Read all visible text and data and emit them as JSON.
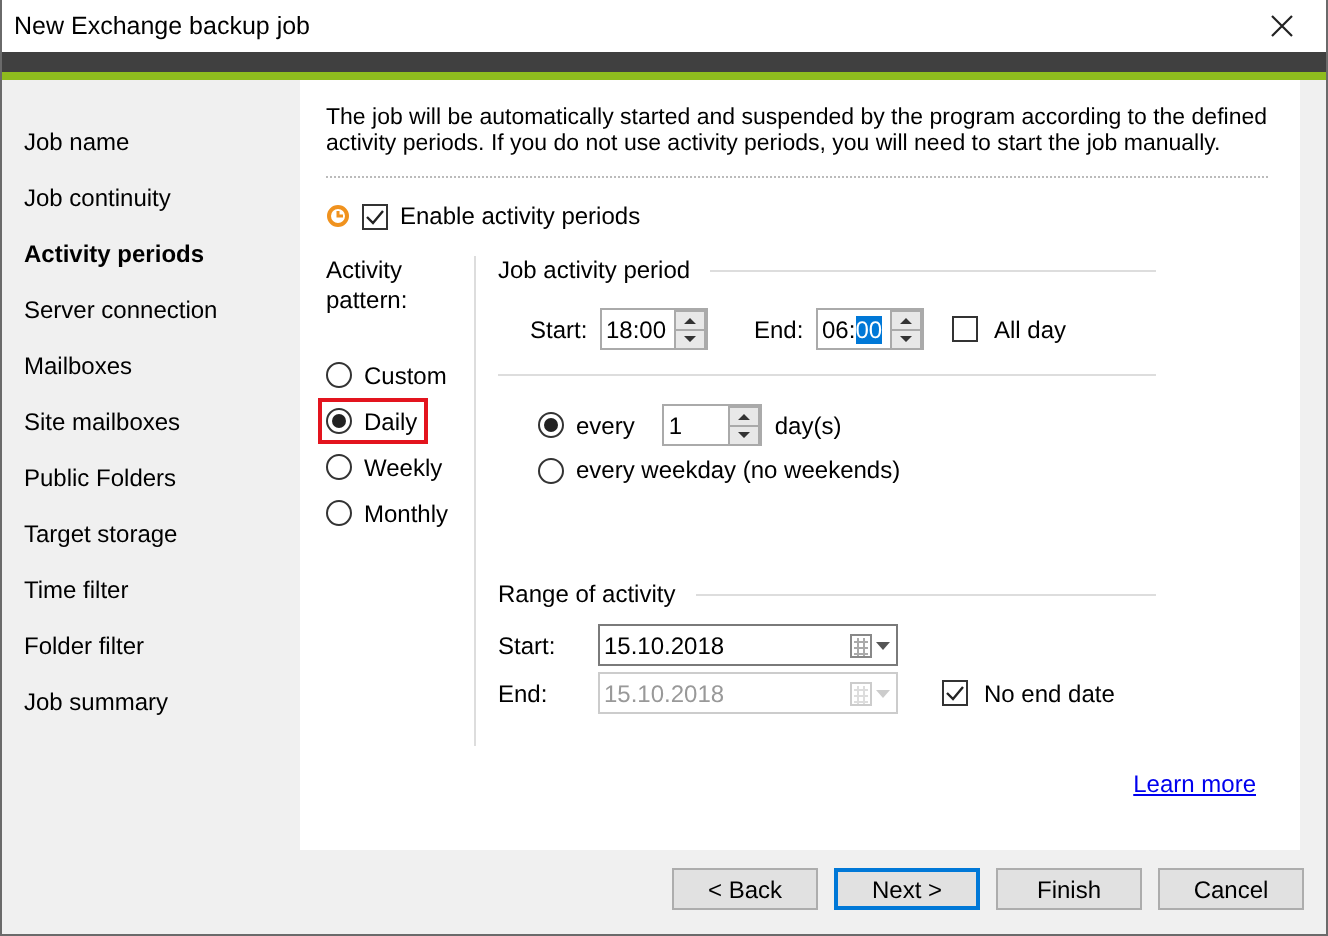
{
  "window": {
    "title": "New Exchange backup job"
  },
  "sidebar": {
    "items": [
      {
        "label": "Job name",
        "selected": false
      },
      {
        "label": "Job continuity",
        "selected": false
      },
      {
        "label": "Activity periods",
        "selected": true
      },
      {
        "label": "Server connection",
        "selected": false
      },
      {
        "label": "Mailboxes",
        "selected": false
      },
      {
        "label": "Site mailboxes",
        "selected": false
      },
      {
        "label": "Public Folders",
        "selected": false
      },
      {
        "label": "Target storage",
        "selected": false
      },
      {
        "label": "Time filter",
        "selected": false
      },
      {
        "label": "Folder filter",
        "selected": false
      },
      {
        "label": "Job summary",
        "selected": false
      }
    ]
  },
  "description": "The job will be automatically started and suspended by the program according to the defined activity periods. If you do not use activity periods, you will need to start the job manually.",
  "enable_activity_periods": {
    "label": "Enable activity periods",
    "checked": true
  },
  "activity_pattern": {
    "label": "Activity pattern:",
    "options": [
      {
        "label": "Custom",
        "selected": false,
        "highlighted": false
      },
      {
        "label": "Daily",
        "selected": true,
        "highlighted": true
      },
      {
        "label": "Weekly",
        "selected": false,
        "highlighted": false
      },
      {
        "label": "Monthly",
        "selected": false,
        "highlighted": false
      }
    ]
  },
  "job_activity_period": {
    "title": "Job activity period",
    "start_label": "Start:",
    "start_value": "18:00",
    "end_label": "End:",
    "end_hours": "06:",
    "end_minutes": "00",
    "end_minutes_selected": true,
    "all_day": {
      "label": "All day",
      "checked": false
    }
  },
  "recurrence": [
    {
      "kind": "every",
      "label": "every",
      "value": "1",
      "unit": "day(s)",
      "selected": true
    },
    {
      "kind": "weekday",
      "label": "every weekday (no weekends)",
      "selected": false
    }
  ],
  "range_of_activity": {
    "title": "Range of activity",
    "start_label": "Start:",
    "start_value": "15.10.2018",
    "end_label": "End:",
    "end_value": "15.10.2018",
    "end_disabled": true,
    "no_end_date": {
      "label": "No end date",
      "checked": true
    }
  },
  "learn_more": "Learn more",
  "buttons": [
    {
      "label": "< Back",
      "focused": false
    },
    {
      "label": "Next >",
      "focused": true
    },
    {
      "label": "Finish",
      "focused": false
    },
    {
      "label": "Cancel",
      "focused": false
    }
  ]
}
